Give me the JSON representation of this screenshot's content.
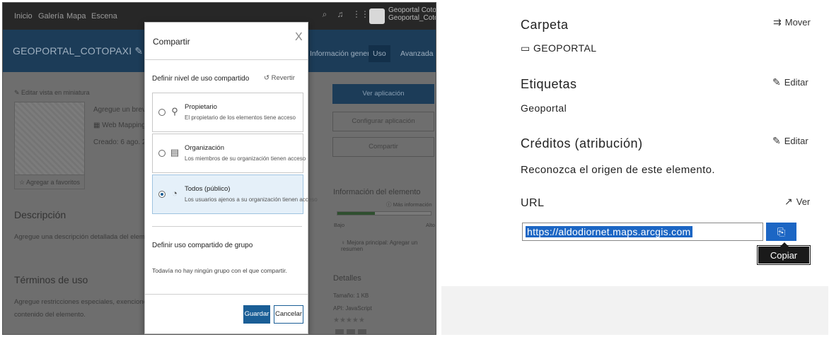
{
  "left": {
    "topnav": {
      "links": [
        "Inicio",
        "Galería",
        "Mapa",
        "Escena"
      ],
      "user_line1": "Geoportal Cotopaxi",
      "user_line2": "Geoportal_Cotopaxi"
    },
    "item_title": "GEOPORTAL_COTOPAXI",
    "tabs": {
      "overview": "Información general",
      "usage": "Uso",
      "advanced": "Avanzada"
    },
    "edit_thumbnail": "Editar vista en miniatura",
    "summary_hint": "Agregue un breve re",
    "item_type": "Web Mapping App",
    "created": "Creado: 6 ago. 2020",
    "favorites": "Agregar a favoritos",
    "description_heading": "Descripción",
    "description_hint": "Agregue una descripción detallada del elemento.",
    "terms_heading": "Términos de uso",
    "terms_hint1": "Agregue restricciones especiales, exenciones de resp",
    "terms_hint2": "contenido del elemento.",
    "right_buttons": {
      "view_app": "Ver aplicación",
      "configure_app": "Configurar aplicación",
      "share": "Compartir"
    },
    "item_info": {
      "heading": "Información del elemento",
      "more_info": "Más información",
      "low": "Bajo",
      "high": "Alto",
      "improve": "Mejora principal: Agregar un resumen",
      "quality": 0.4
    },
    "details": {
      "heading": "Detalles",
      "size": "Tamaño: 1 KB",
      "api": "API: JavaScript",
      "stars": "★★★★★"
    }
  },
  "dialog": {
    "title": "Compartir",
    "close": "X",
    "level_heading": "Definir nivel de uso compartido",
    "revert": "Revertir",
    "options": [
      {
        "label": "Propietario",
        "desc": "El propietario de los elementos tiene acceso",
        "icon": "owner-icon"
      },
      {
        "label": "Organización",
        "desc": "Los miembros de su organización tienen acceso",
        "icon": "organization-icon"
      },
      {
        "label": "Todos (público)",
        "desc": "Los usuarios ajenos a su organización tienen acceso",
        "icon": "globe-icon"
      }
    ],
    "selected_option": 2,
    "group_heading": "Definir uso compartido de grupo",
    "group_empty": "Todavía no hay ningún grupo con el que compartir.",
    "save": "Guardar",
    "cancel": "Cancelar"
  },
  "right": {
    "folder_heading": "Carpeta",
    "move": "Mover",
    "folder_value": "GEOPORTAL",
    "tags_heading": "Etiquetas",
    "tags_edit": "Editar",
    "tags_value": "Geoportal",
    "credits_heading": "Créditos (atribución)",
    "credits_edit": "Editar",
    "credits_value": "Reconozca el origen de este elemento.",
    "url_heading": "URL",
    "view": "Ver",
    "url_value": "https://aldodiornet.maps.arcgis.com",
    "copy_tooltip": "Copiar"
  },
  "colors": {
    "accent": "#1c66c4",
    "nav": "#272727",
    "titlebar": "#1c3c58",
    "dialog_primary": "#1a5e96"
  }
}
